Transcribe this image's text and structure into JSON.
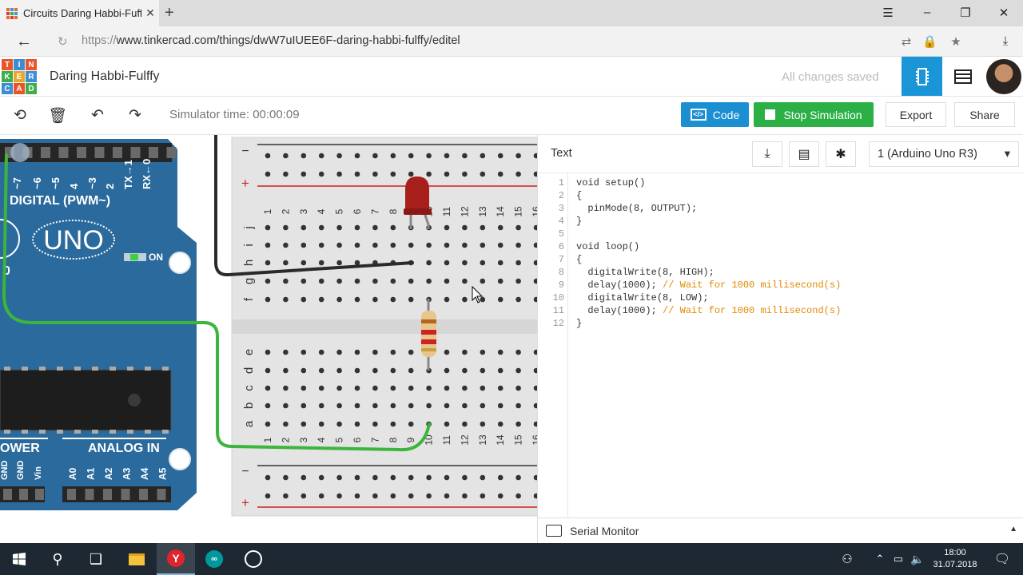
{
  "browser": {
    "tab_title": "Circuits Daring Habbi-Fuff",
    "url_prefix": "https://",
    "url_rest": "www.tinkercad.com/things/dwW7uIUEE6F-daring-habbi-fulffy/editel"
  },
  "header": {
    "logo_letters": [
      "T",
      "I",
      "N",
      "K",
      "E",
      "R",
      "C",
      "A",
      "D"
    ],
    "project_name": "Daring Habbi-Fulffy",
    "save_status": "All changes saved"
  },
  "toolbar": {
    "sim_time": "Simulator time: 00:00:09",
    "code_label": "Code",
    "stop_label": "Stop Simulation",
    "export_label": "Export",
    "share_label": "Share"
  },
  "code_panel": {
    "mode": "Text",
    "device": "1 (Arduino Uno R3)",
    "serial_monitor": "Serial Monitor",
    "lines": [
      {
        "n": "1",
        "code": "void setup()",
        "comment": ""
      },
      {
        "n": "2",
        "code": "{",
        "comment": ""
      },
      {
        "n": "3",
        "code": "  pinMode(8, OUTPUT);",
        "comment": ""
      },
      {
        "n": "4",
        "code": "}",
        "comment": ""
      },
      {
        "n": "5",
        "code": "",
        "comment": ""
      },
      {
        "n": "6",
        "code": "void loop()",
        "comment": ""
      },
      {
        "n": "7",
        "code": "{",
        "comment": ""
      },
      {
        "n": "8",
        "code": "  digitalWrite(8, HIGH);",
        "comment": ""
      },
      {
        "n": "9",
        "code": "  delay(1000); ",
        "comment": "// Wait for 1000 millisecond(s)"
      },
      {
        "n": "10",
        "code": "  digitalWrite(8, LOW);",
        "comment": ""
      },
      {
        "n": "11",
        "code": "  delay(1000); ",
        "comment": "// Wait for 1000 millisecond(s)"
      },
      {
        "n": "12",
        "code": "}",
        "comment": ""
      }
    ]
  },
  "board": {
    "digital": "DIGITAL (PWM~)",
    "model": "UNO",
    "on": "ON",
    "power": "OWER",
    "analog": "ANALOG IN",
    "pins_top": [
      "~7",
      "~6",
      "~5",
      "4",
      "~3",
      "2",
      "TX→1",
      "RX←0"
    ],
    "pins_power": [
      "GND",
      "GND",
      "Vin"
    ],
    "pins_analog": [
      "A0",
      "A1",
      "A2",
      "A3",
      "A4",
      "A5"
    ],
    "ten": "0"
  },
  "breadboard": {
    "rows_top": [
      "j",
      "i",
      "h",
      "g",
      "f"
    ],
    "rows_bottom": [
      "e",
      "d",
      "c",
      "b",
      "a"
    ],
    "columns": [
      "1",
      "2",
      "3",
      "4",
      "5",
      "6",
      "7",
      "8",
      "9",
      "10",
      "11",
      "12",
      "13",
      "14",
      "15",
      "16"
    ],
    "minus": "−",
    "plus": "+"
  },
  "taskbar": {
    "time": "18:00",
    "date": "31.07.2018"
  },
  "colors": {
    "accent": "#1a95d8",
    "stop_green": "#2bb046",
    "board_blue": "#2a6a9c",
    "wire_green": "#3cb53c",
    "led_red": "#b3201c"
  }
}
